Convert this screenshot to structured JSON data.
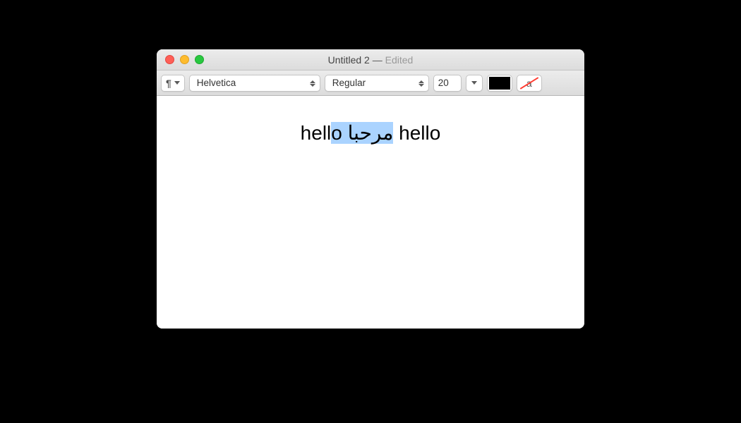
{
  "window": {
    "title_name": "Untitled 2",
    "title_sep": " — ",
    "title_status": "Edited"
  },
  "toolbar": {
    "paragraph_symbol": "¶",
    "font_family": "Helvetica",
    "font_weight": "Regular",
    "font_size": "20",
    "text_color": "#000000",
    "highlight_letter": "a"
  },
  "document": {
    "pre_selection": "hell",
    "selection": "o مرحبا",
    "post_selection": " hello"
  }
}
